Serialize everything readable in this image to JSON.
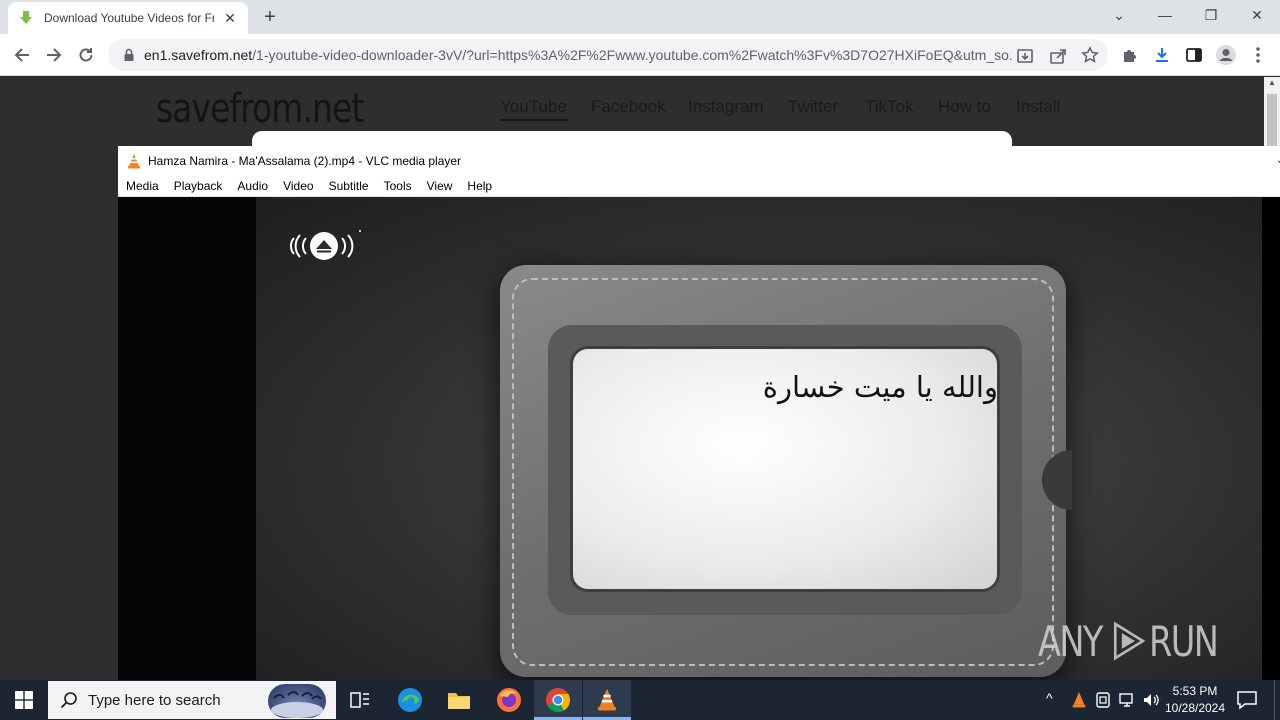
{
  "browser": {
    "tab_title": "Download Youtube Videos for Free",
    "tab_close": "✕",
    "new_tab": "+",
    "url_host": "en1.savefrom.net",
    "url_path": "/1-youtube-video-downloader-3vV/?url=https%3A%2F%2Fwww.youtube.com%2Fwatch%3Fv%3D7O27HXiFoEQ&utm_so...",
    "window_controls": {
      "minimize": "—",
      "maximize": "❐",
      "close": "✕",
      "tab_search": "⌄"
    }
  },
  "site": {
    "logo": "savefrom.net",
    "nav": [
      "YouTube",
      "Facebook",
      "Instagram",
      "Twitter",
      "TikTok",
      "How to",
      "Install"
    ]
  },
  "vlc": {
    "title": "Hamza Namira - Ma'Assalama  (2).mp4 - VLC media player",
    "menu": [
      "Media",
      "Playback",
      "Audio",
      "Video",
      "Subtitle",
      "Tools",
      "View",
      "Help"
    ],
    "video_text": "والله يا ميت خسارة",
    "watermark_left": "ANY",
    "watermark_right": "RUN"
  },
  "taskbar": {
    "search_placeholder": "Type here to search",
    "time": "5:53 PM",
    "date": "10/28/2024",
    "tray_chevron": "^"
  },
  "colors": {
    "chrome_tabstrip": "#dee1e6",
    "taskbar": "#1c2534",
    "download_accent": "#1a73e8",
    "vlc_orange": "#f58220"
  }
}
